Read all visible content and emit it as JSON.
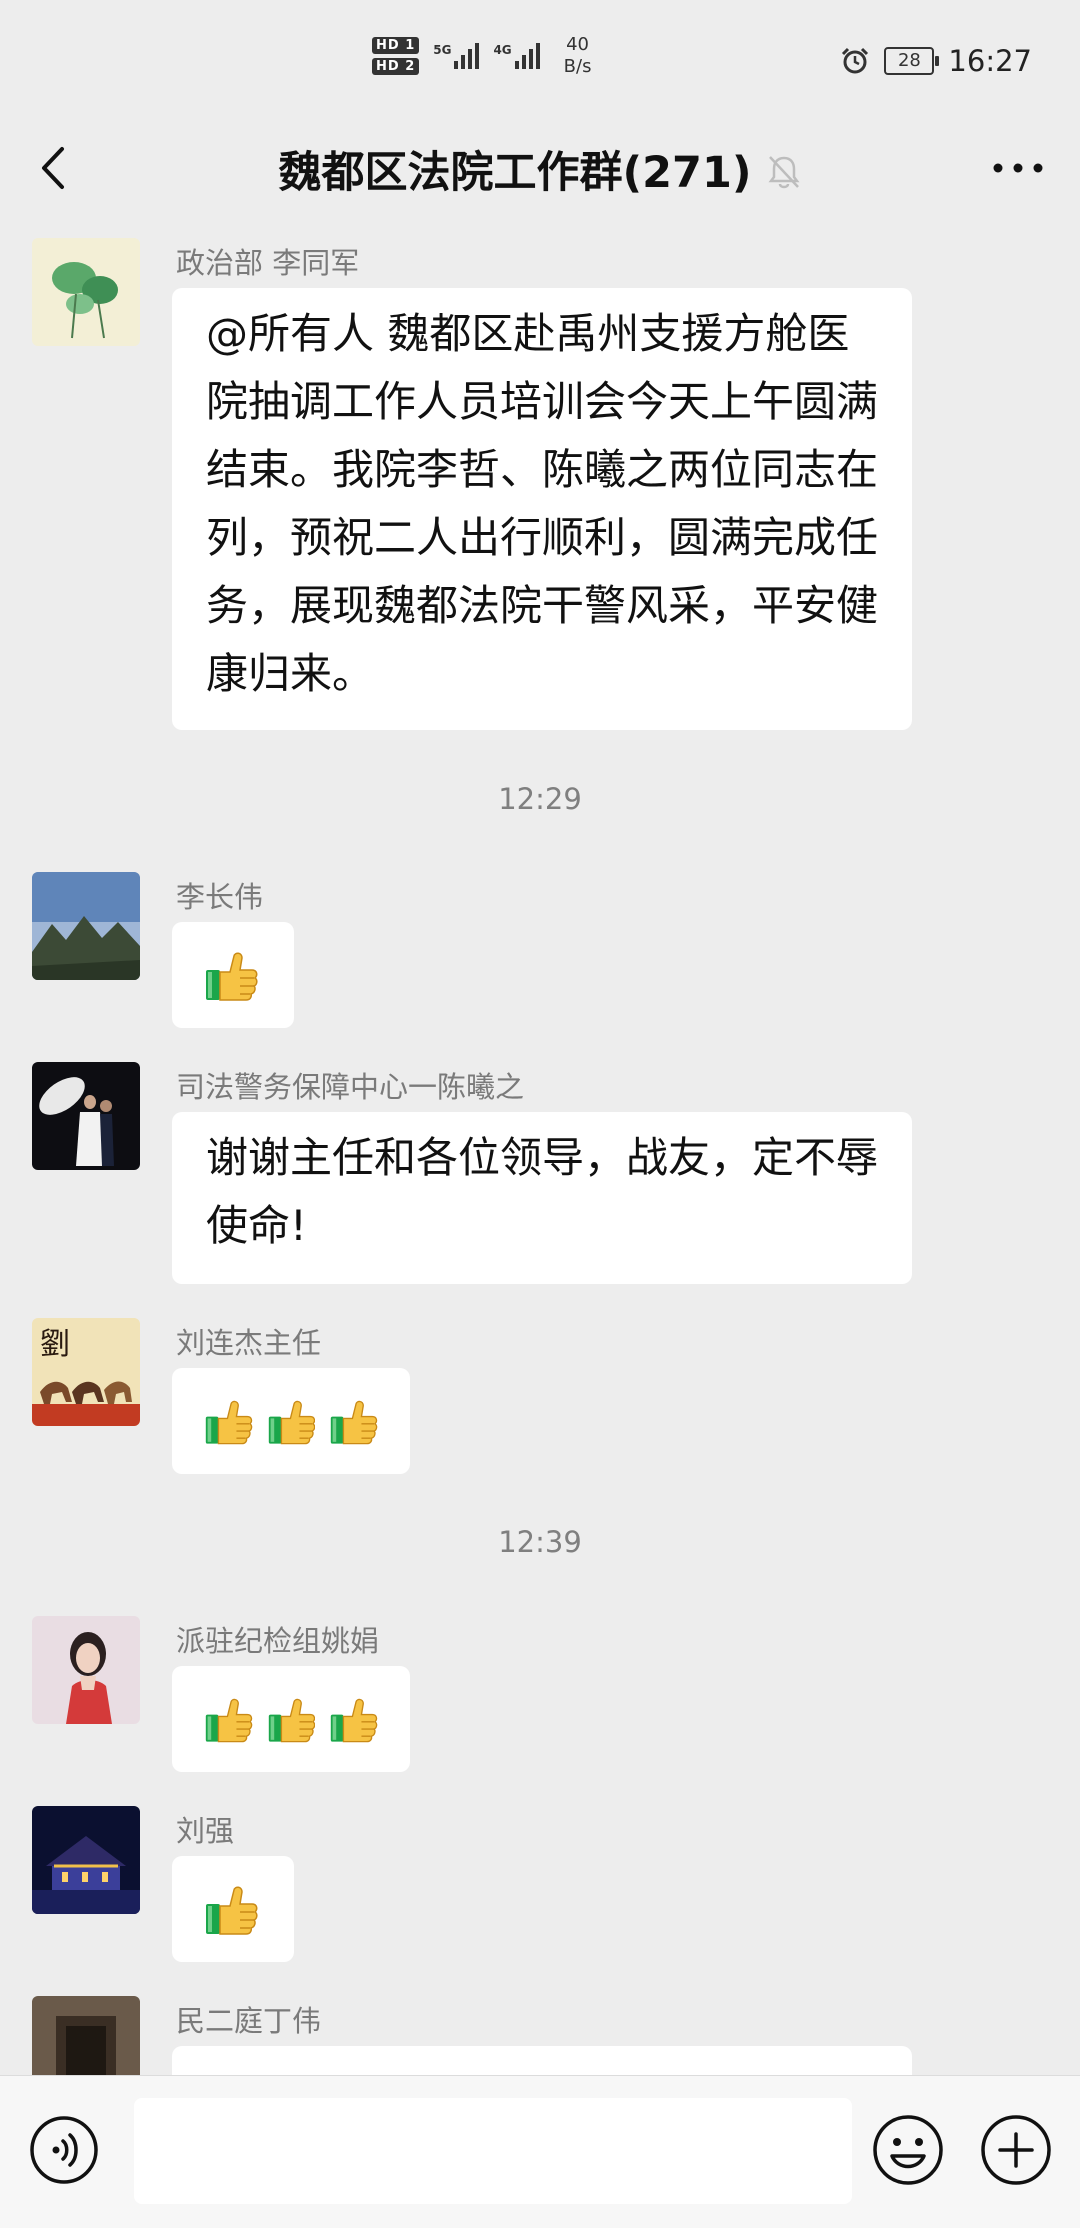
{
  "status_bar": {
    "sim1": "HD 1",
    "sim2": "HD 2",
    "net1": "5G",
    "net2": "4G",
    "speed_value": "40",
    "speed_unit": "B/s",
    "battery": "28",
    "time": "16:27"
  },
  "header": {
    "title": "魏都区法院工作群(271)"
  },
  "messages": [
    {
      "sender": "政治部 李同军",
      "text": "@所有人  魏都区赴禹州支援方舱医院抽调工作人员培训会今天上午圆满结束。我院李哲、陈曦之两位同志在列，预祝二人出行顺利，圆满完成任务，展现魏都法院干警风采，平安健康归来。"
    },
    {
      "sender": "李长伟",
      "thumbs": 1
    },
    {
      "sender": "司法警务保障中心一陈曦之",
      "text": "谢谢主任和各位领导，战友，定不辱使命!"
    },
    {
      "sender": "刘连杰主任",
      "thumbs": 3
    },
    {
      "sender": "派驻纪检组姚娟",
      "thumbs": 3
    },
    {
      "sender": "刘强",
      "thumbs": 1
    },
    {
      "sender": "民二庭丁伟"
    }
  ],
  "time_separators": [
    "12:29",
    "12:39"
  ],
  "input": {
    "value": "",
    "placeholder": ""
  },
  "icons": [
    "back-icon",
    "mute-bell-icon",
    "more-icon",
    "voice-icon",
    "emoji-icon",
    "plus-icon",
    "thumbs-up-icon"
  ],
  "colors": {
    "background": "#ededed",
    "bubble": "#ffffff",
    "meta_text": "#7f7f7f",
    "thumb_yellow": "#f6c344",
    "thumb_cuff": "#1aa64a"
  }
}
